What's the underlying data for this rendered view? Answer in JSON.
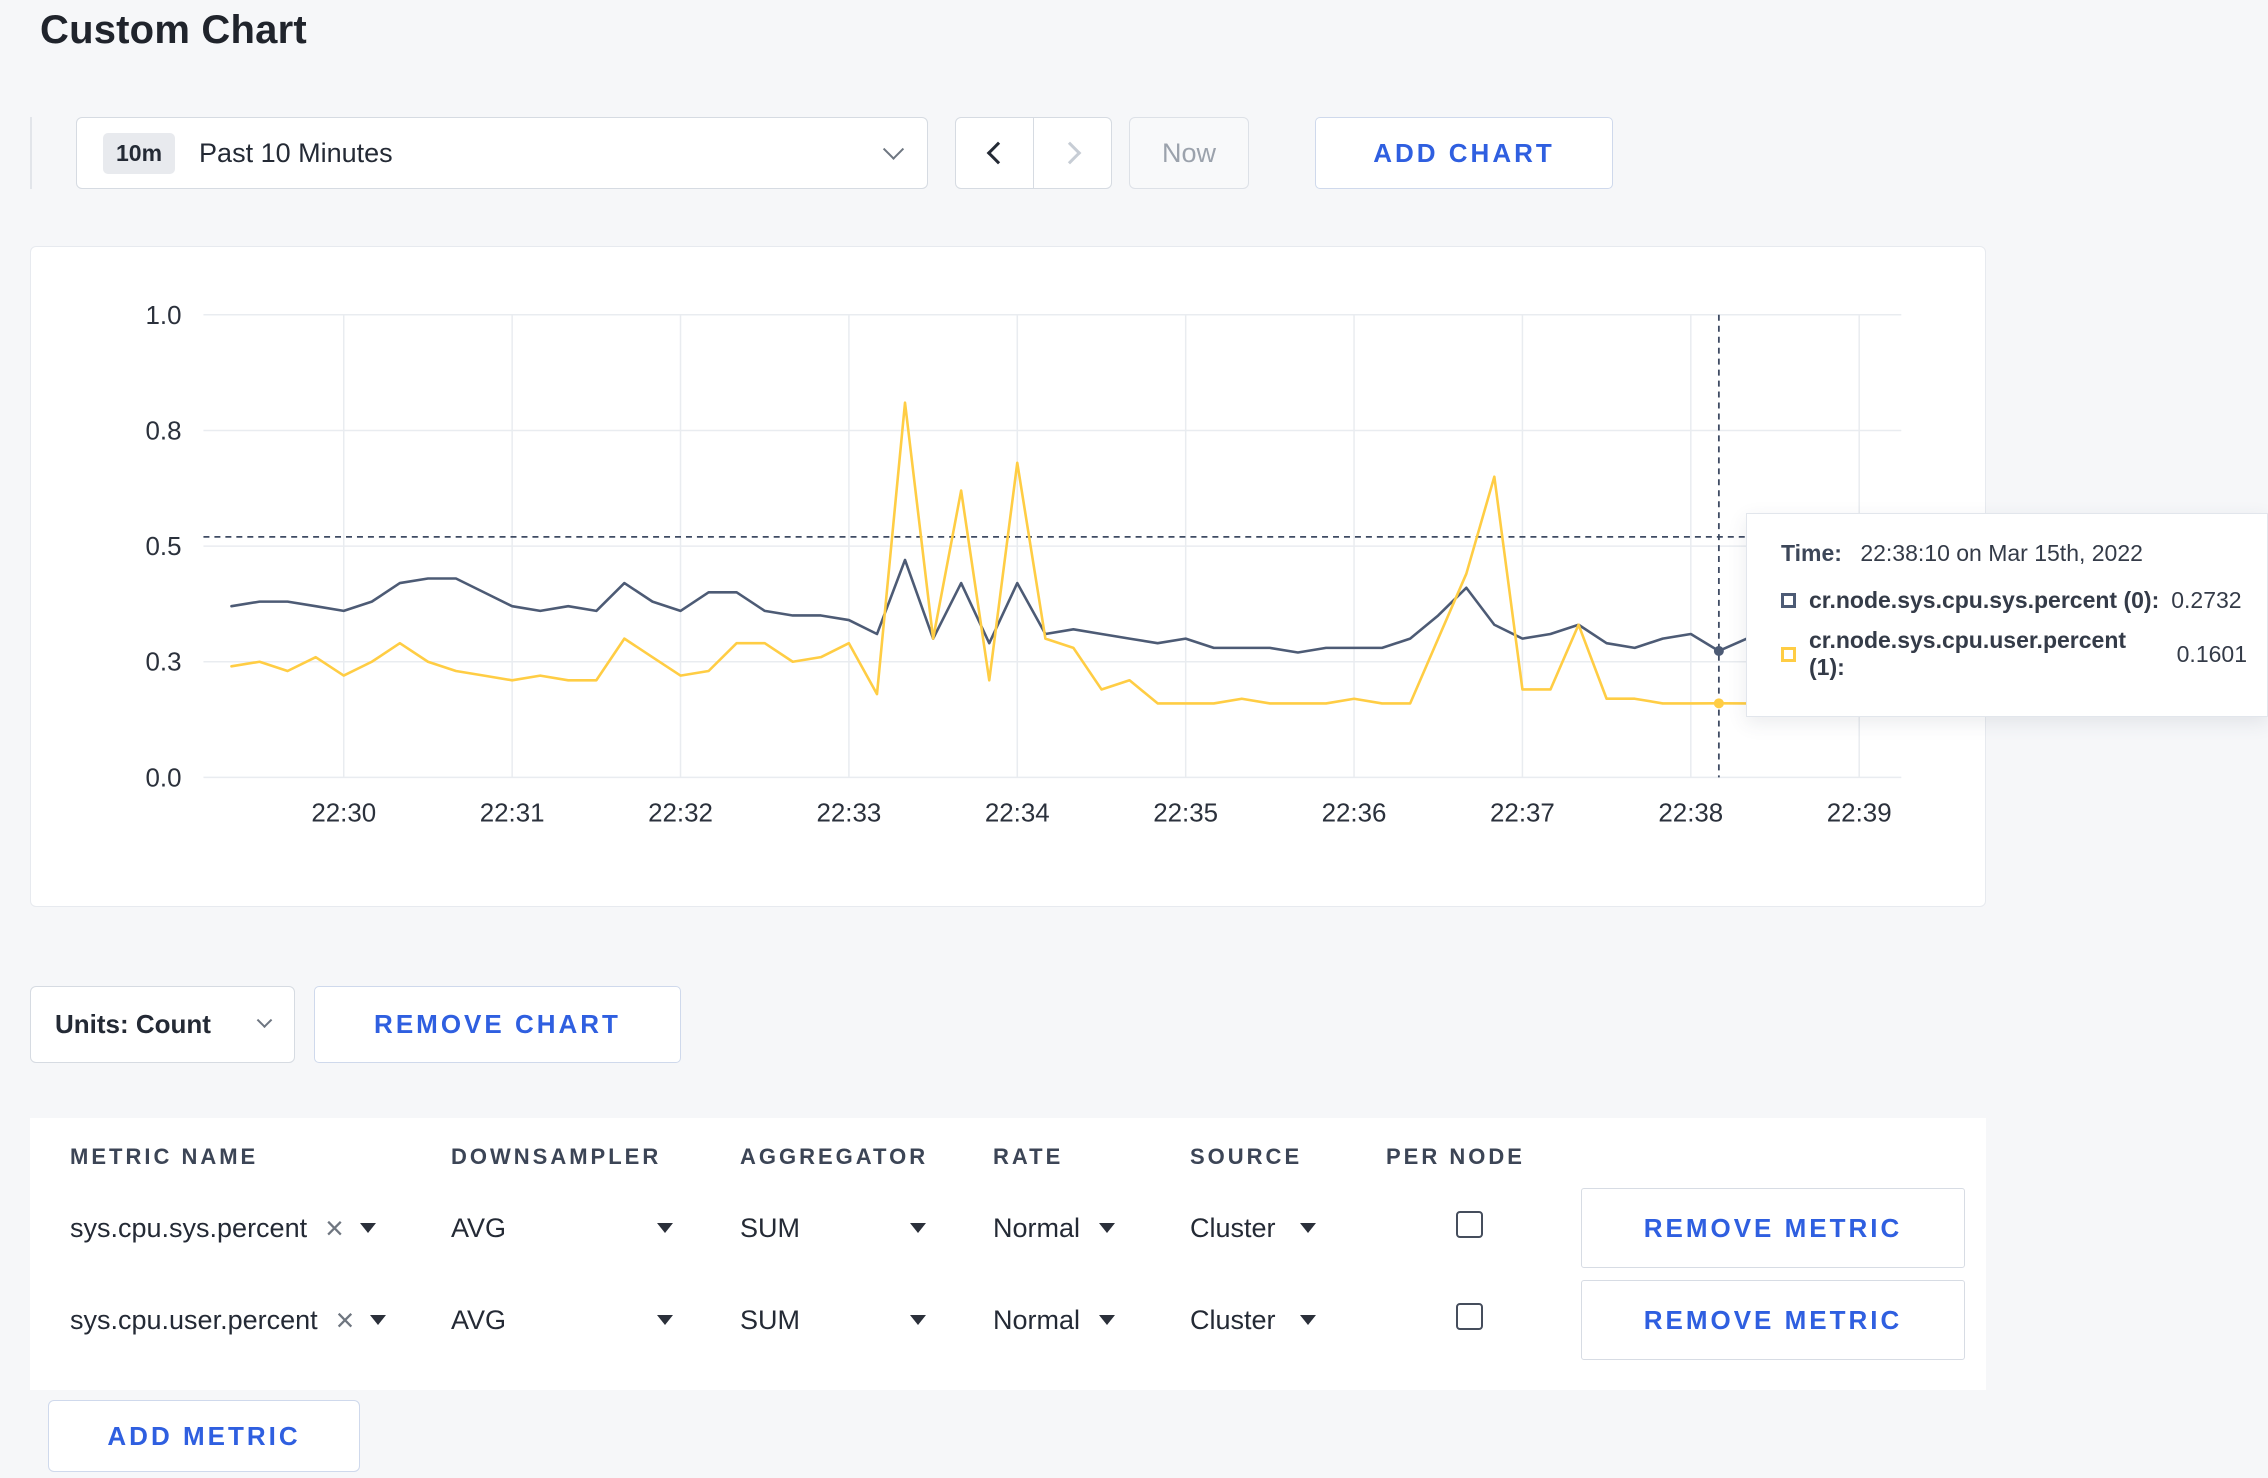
{
  "page": {
    "title": "Custom Chart"
  },
  "toolbar": {
    "range_badge": "10m",
    "range_label": "Past 10 Minutes",
    "now_label": "Now",
    "add_chart_label": "ADD CHART"
  },
  "chart_data": {
    "type": "line",
    "title": "",
    "xlabel": "",
    "ylabel": "",
    "ylim": [
      0,
      1
    ],
    "grid": true,
    "x_domain": [
      "22:29:10",
      "22:39:15"
    ],
    "x_ticks": [
      "22:30",
      "22:31",
      "22:32",
      "22:33",
      "22:34",
      "22:35",
      "22:36",
      "22:37",
      "22:38",
      "22:39"
    ],
    "y_ticks": {
      "values": [
        0,
        0.25,
        0.5,
        0.75,
        1
      ],
      "labels": [
        "0.0",
        "0.3",
        "0.5",
        "0.8",
        "1.0"
      ]
    },
    "interval_seconds": 10,
    "crosshair": {
      "time": "22:38:10",
      "hover_value": 0.52
    },
    "series": [
      {
        "name": "cr.node.sys.cpu.sys.percent",
        "color": "#4d5b75",
        "start": "22:29:20",
        "values": [
          0.37,
          0.38,
          0.38,
          0.37,
          0.36,
          0.38,
          0.42,
          0.43,
          0.43,
          0.4,
          0.37,
          0.36,
          0.37,
          0.36,
          0.42,
          0.38,
          0.36,
          0.4,
          0.4,
          0.36,
          0.35,
          0.35,
          0.34,
          0.31,
          0.47,
          0.3,
          0.42,
          0.29,
          0.42,
          0.31,
          0.32,
          0.31,
          0.3,
          0.29,
          0.3,
          0.28,
          0.28,
          0.28,
          0.27,
          0.28,
          0.28,
          0.28,
          0.3,
          0.35,
          0.41,
          0.33,
          0.3,
          0.31,
          0.33,
          0.29,
          0.28,
          0.3,
          0.31,
          0.2732,
          0.3,
          0.31,
          0.3,
          0.31,
          0.3
        ]
      },
      {
        "name": "cr.node.sys.cpu.user.percent",
        "color": "#ffcd44",
        "start": "22:29:20",
        "values": [
          0.24,
          0.25,
          0.23,
          0.26,
          0.22,
          0.25,
          0.29,
          0.25,
          0.23,
          0.22,
          0.21,
          0.22,
          0.21,
          0.21,
          0.3,
          0.26,
          0.22,
          0.23,
          0.29,
          0.29,
          0.25,
          0.26,
          0.29,
          0.18,
          0.81,
          0.3,
          0.62,
          0.21,
          0.68,
          0.3,
          0.28,
          0.19,
          0.21,
          0.16,
          0.16,
          0.16,
          0.17,
          0.16,
          0.16,
          0.16,
          0.17,
          0.16,
          0.16,
          0.3,
          0.44,
          0.65,
          0.19,
          0.19,
          0.33,
          0.17,
          0.17,
          0.16,
          0.16,
          0.1601,
          0.16,
          0.15,
          0.15,
          0.21,
          0.27
        ]
      }
    ]
  },
  "tooltip": {
    "time_label": "Time:",
    "time_value": "22:38:10 on Mar 15th, 2022",
    "rows": [
      {
        "label": "cr.node.sys.cpu.sys.percent (0):",
        "value": "0.2732",
        "color": "#4d5b75"
      },
      {
        "label": "cr.node.sys.cpu.user.percent (1):",
        "value": "0.1601",
        "color": "#ffcd44"
      }
    ]
  },
  "controls": {
    "units_label": "Units: Count",
    "remove_chart_label": "REMOVE CHART",
    "add_metric_label": "ADD METRIC"
  },
  "metrics_table": {
    "headers": [
      "METRIC NAME",
      "DOWNSAMPLER",
      "AGGREGATOR",
      "RATE",
      "SOURCE",
      "PER NODE"
    ],
    "remove_metric_label": "REMOVE METRIC",
    "clear_icon": "×",
    "rows": [
      {
        "metric": "sys.cpu.sys.percent",
        "downsampler": "AVG",
        "aggregator": "SUM",
        "rate": "Normal",
        "source": "Cluster",
        "per_node_checked": false
      },
      {
        "metric": "sys.cpu.user.percent",
        "downsampler": "AVG",
        "aggregator": "SUM",
        "rate": "Normal",
        "source": "Cluster",
        "per_node_checked": false
      }
    ]
  },
  "colors": {
    "accent": "#2f5fe0",
    "series_sys": "#4d5b75",
    "series_user": "#ffcd44",
    "crosshair": "#3f4b63",
    "grid": "#e9ecf0"
  }
}
